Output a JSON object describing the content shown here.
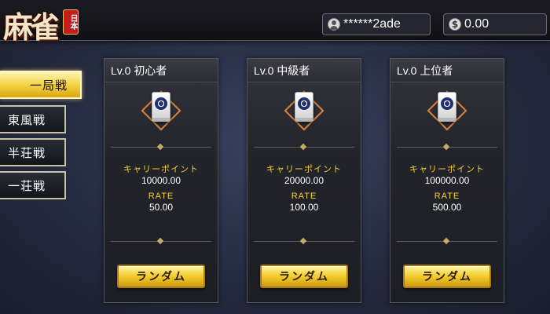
{
  "header": {
    "logo_text": "麻雀",
    "logo_badge": "日本",
    "username": "******2ade",
    "balance": "0.00",
    "user_icon": "user-icon",
    "coin_icon": "dollar-coin-icon"
  },
  "sidebar": {
    "items": [
      {
        "label": "一局戦",
        "active": true
      },
      {
        "label": "東風戦",
        "active": false
      },
      {
        "label": "半荘戦",
        "active": false
      },
      {
        "label": "一荘戦",
        "active": false
      }
    ]
  },
  "rooms": [
    {
      "title": "Lv.0 初心者",
      "carry_label": "キャリーポイント",
      "carry_value": "10000.00",
      "rate_label": "RATE",
      "rate_value": "50.00",
      "button_label": "ランダム"
    },
    {
      "title": "Lv.0 中級者",
      "carry_label": "キャリーポイント",
      "carry_value": "20000.00",
      "rate_label": "RATE",
      "rate_value": "100.00",
      "button_label": "ランダム"
    },
    {
      "title": "Lv.0 上位者",
      "carry_label": "キャリーポイント",
      "carry_value": "100000.00",
      "rate_label": "RATE",
      "rate_value": "500.00",
      "button_label": "ランダム"
    }
  ],
  "colors": {
    "accent_gold": "#f3cf3a",
    "tile_border": "#d7843a",
    "background": "#262c40"
  }
}
